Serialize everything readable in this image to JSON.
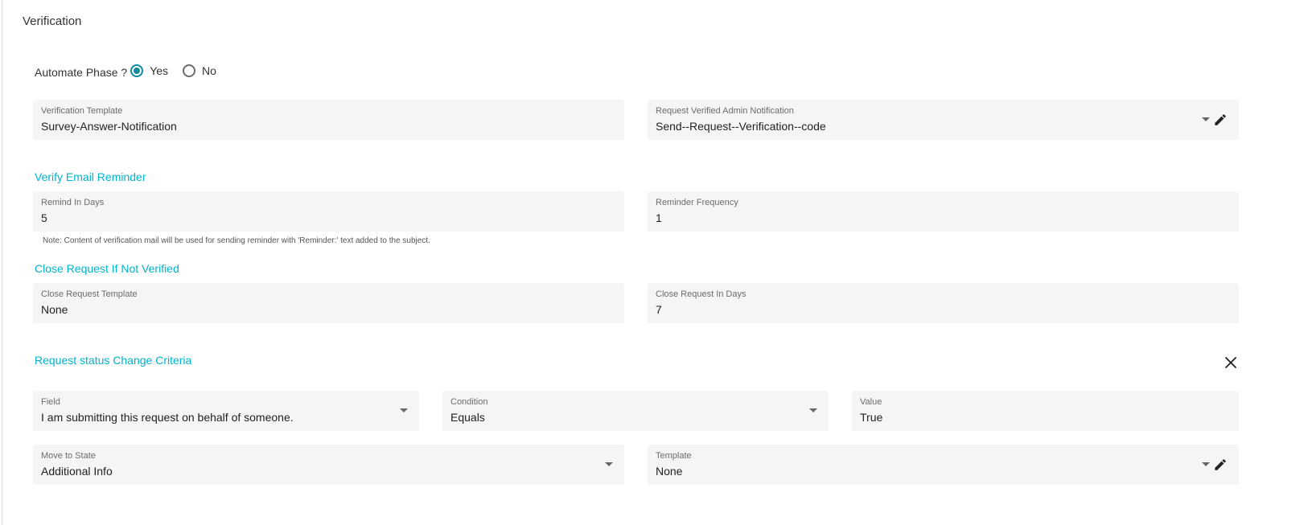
{
  "section": {
    "title": "Verification"
  },
  "automate": {
    "label": "Automate Phase ?",
    "options": [
      {
        "label": "Yes",
        "selected": true
      },
      {
        "label": "No",
        "selected": false
      }
    ]
  },
  "verification_template": {
    "label": "Verification Template",
    "value": "Survey-Answer-Notification"
  },
  "admin_notification": {
    "label": "Request Verified Admin Notification",
    "value": "Send--Request--Verification--code"
  },
  "email_reminder": {
    "title": "Verify Email Reminder",
    "remind_in_days": {
      "label": "Remind In Days",
      "value": "5"
    },
    "reminder_frequency": {
      "label": "Reminder Frequency",
      "value": "1"
    },
    "note": "Note: Content of verification mail will be used for sending reminder with 'Reminder:' text added to the subject."
  },
  "close_request": {
    "title": "Close Request If Not Verified",
    "template": {
      "label": "Close Request Template",
      "value": "None"
    },
    "days": {
      "label": "Close Request In Days",
      "value": "7"
    }
  },
  "status_criteria": {
    "title": "Request status Change Criteria",
    "field": {
      "label": "Field",
      "value": "I am submitting this request on behalf of someone."
    },
    "condition": {
      "label": "Condition",
      "value": "Equals"
    },
    "value": {
      "label": "Value",
      "value": "True"
    },
    "move_to_state": {
      "label": "Move to State",
      "value": "Additional Info"
    },
    "template": {
      "label": "Template",
      "value": "None"
    }
  },
  "colors": {
    "accent": "#00b3cc",
    "radio": "#0f8a9d",
    "field_bg": "#f5f5f5"
  },
  "icons": {
    "edit": "pencil-icon",
    "dropdown": "dropdown-arrow-icon",
    "close": "close-icon"
  }
}
